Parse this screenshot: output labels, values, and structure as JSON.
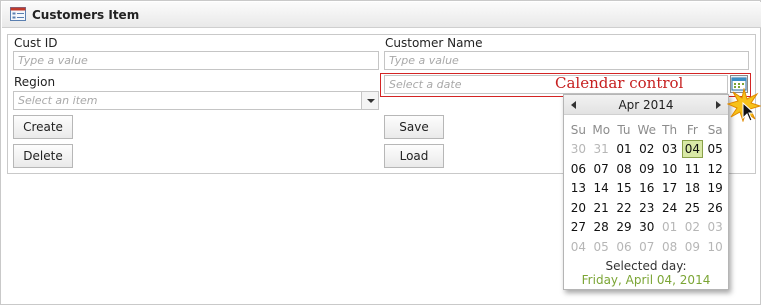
{
  "window": {
    "title": "Customers Item",
    "icon": "list-form-icon"
  },
  "form": {
    "cust_id": {
      "label": "Cust ID",
      "placeholder": "Type a value"
    },
    "customer_name": {
      "label": "Customer Name",
      "placeholder": "Type a value"
    },
    "region": {
      "label": "Region",
      "placeholder": "Select an item"
    },
    "date": {
      "placeholder": "Select a date"
    }
  },
  "buttons": {
    "create": "Create",
    "delete": "Delete",
    "save": "Save",
    "load": "Load"
  },
  "annotation": {
    "text": "Calendar control",
    "color": "#c62020"
  },
  "calendar": {
    "month_label": "Apr 2014",
    "weekdays": [
      "Su",
      "Mo",
      "Tu",
      "We",
      "Th",
      "Fr",
      "Sa"
    ],
    "weeks": [
      [
        "30",
        "31",
        "01",
        "02",
        "03",
        "04",
        "05"
      ],
      [
        "06",
        "07",
        "08",
        "09",
        "10",
        "11",
        "12"
      ],
      [
        "13",
        "14",
        "15",
        "16",
        "17",
        "18",
        "19"
      ],
      [
        "20",
        "21",
        "22",
        "23",
        "24",
        "25",
        "26"
      ],
      [
        "27",
        "28",
        "29",
        "30",
        "01",
        "02",
        "03"
      ],
      [
        "04",
        "05",
        "06",
        "07",
        "08",
        "09",
        "10"
      ]
    ],
    "selected_day": "04",
    "selected_label": "Selected day:",
    "selected_value": "Friday, April 04, 2014",
    "accent": "#7ba535",
    "selected_fill": "#d9e9a6"
  }
}
